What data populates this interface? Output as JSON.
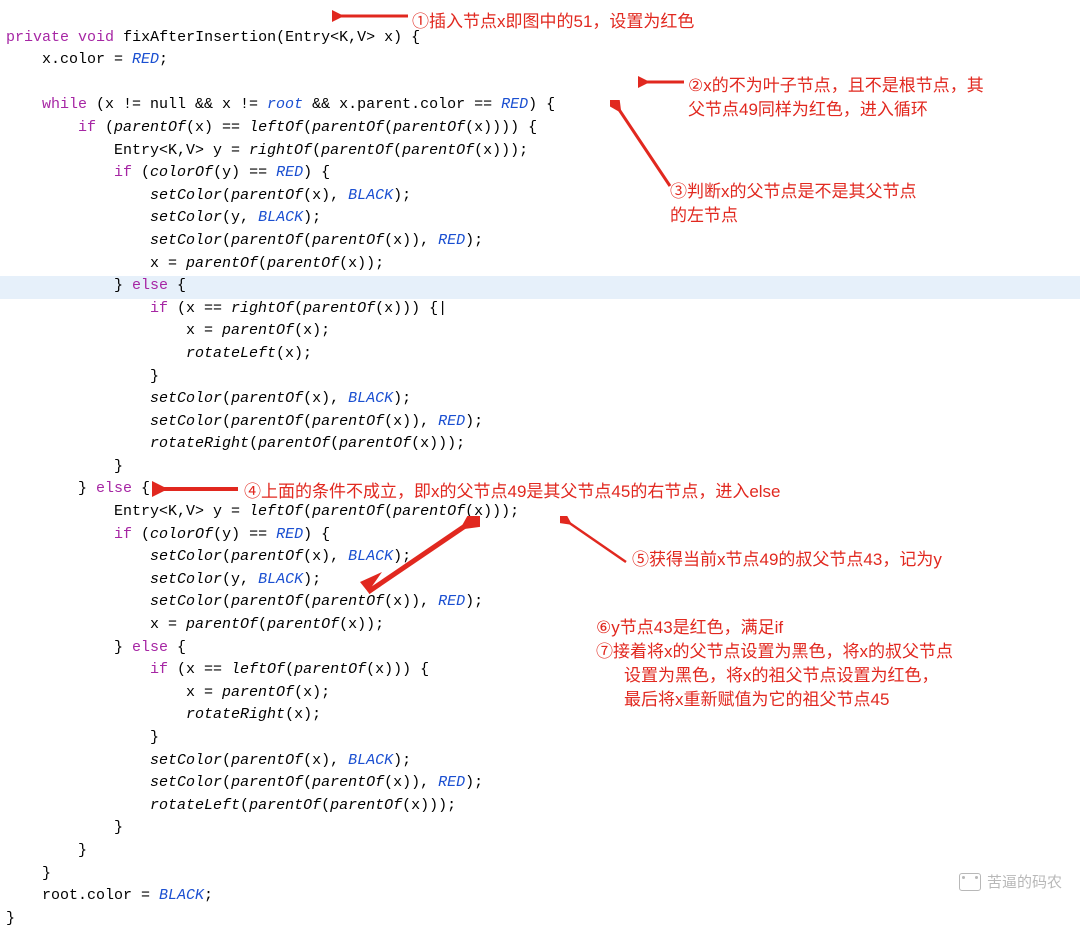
{
  "code": {
    "l1": "private",
    "l1b": "void",
    "l1c": "fixAfterInsertion",
    "l1d": "(Entry<K,V> x) {",
    "l2a": "    x.color = ",
    "RED": "RED",
    "BLACK": "BLACK",
    "semi": ";",
    "l4": "    while",
    "l4b": " (x != null && x != ",
    "root": "root",
    "l4c": " && x.parent.color == ",
    "l4d": ") {",
    "l5a": "        if",
    "l5b": " (",
    "parentOf": "parentOf",
    "leftOf": "leftOf",
    "rightOf": "rightOf",
    "colorOf": "colorOf",
    "setColor": "setColor",
    "rotateLeft": "rotateLeft",
    "rotateRight": "rotateRight",
    "l5c": "(x) == ",
    "l5d": "(x)))) {",
    "l6": "            Entry<K,V> y = ",
    "l6b": "(x)));",
    "l7": "            if",
    "l7b": " (",
    "l7c": "(y) == ",
    "l7d": ") {",
    "l8": "                ",
    "l8b": "(x), ",
    "l8c": ");",
    "l9": "                ",
    "l9b": "(y, ",
    "l10": "                ",
    "l10b": "(x)), ",
    "l11": "                x = ",
    "l11b": "(x));",
    "l12": "            } else {",
    "else": "else",
    "l13": "                if",
    "l13b": " (x == ",
    "l13c": "(x))) {",
    "caret": "|",
    "l14": "                    x = ",
    "l14b": "(x);",
    "l15": "                    ",
    "l16": "                }",
    "l17": "                ",
    "l18": "                ",
    "l19": "                ",
    "l19b": "(x)));",
    "l20": "            }",
    "l21": "        } ",
    "l21b": " {",
    "l22": "            Entry<K,V> y = ",
    "l33": "        }",
    "l34": "    }",
    "l35": "    root.color = ",
    "l36": "}"
  },
  "ann": {
    "a1": "①插入节点x即图中的51，设置为红色",
    "a2a": "②x的不为叶子节点，且不是根节点，其",
    "a2b": "父节点49同样为红色，进入循环",
    "a3a": "③判断x的父节点是不是其父节点",
    "a3b": "的左节点",
    "a4": "④上面的条件不成立，即x的父节点49是其父节点45的右节点，进入else",
    "a5": "⑤获得当前x节点49的叔父节点43，记为y",
    "a6": "⑥y节点43是红色，满足if",
    "a7a": "⑦接着将x的父节点设置为黑色，将x的叔父节点",
    "a7b": "设置为黑色，将x的祖父节点设置为红色，",
    "a7c": "最后将x重新赋值为它的祖父节点45"
  },
  "watermark": "苦逼的码农"
}
